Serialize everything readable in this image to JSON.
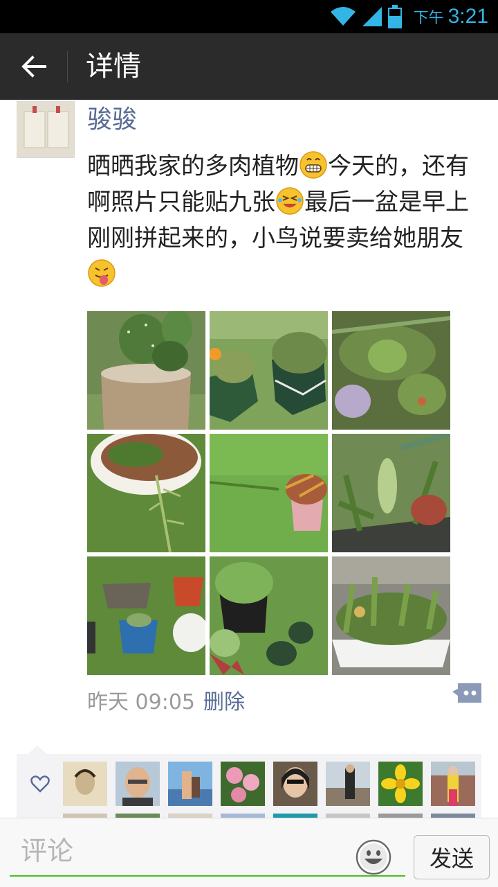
{
  "status_bar": {
    "ampm": "下午",
    "time": "3:21"
  },
  "header": {
    "title": "详情"
  },
  "post": {
    "author": "骏骏",
    "avatar_text": "骏骏",
    "text_1": "晒晒我家的多肉植物",
    "text_2": "今天的，还有啊照片只能贴九张",
    "text_3": "最后一盆是早上刚刚拼起来的，小鸟说要卖给她朋友",
    "time": "昨天 09:05",
    "delete_label": "删除",
    "photo_count": 9
  },
  "likes": {
    "icon": "heart-icon",
    "avatar_count": 8
  },
  "comment_bar": {
    "placeholder": "评论",
    "send_label": "发送",
    "emoji_icon": "smiley-icon"
  },
  "colors": {
    "link": "#576b95",
    "accent_green": "#45c01a",
    "status_blue": "#33b5e5",
    "titlebar": "#2b2b2b"
  }
}
